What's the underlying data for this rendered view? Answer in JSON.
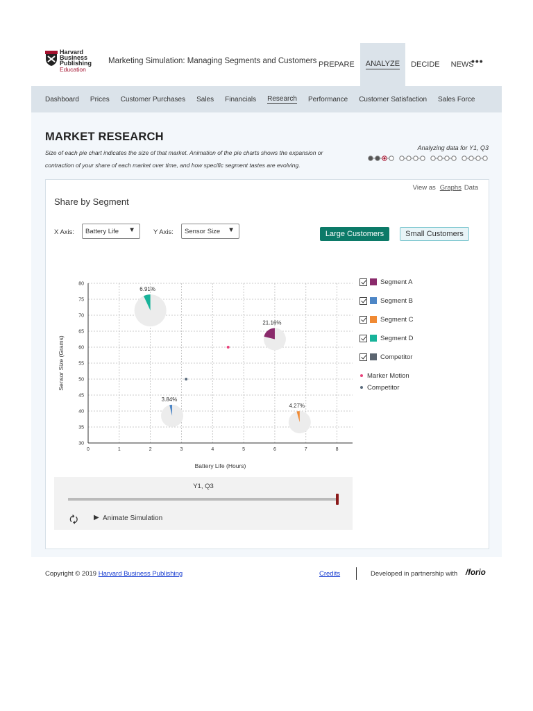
{
  "header": {
    "logo": {
      "line1": "Harvard",
      "line2": "Business",
      "line3": "Publishing",
      "line4": "Education"
    },
    "app_title": "Marketing Simulation: Managing Segments and Customers",
    "nav": [
      {
        "label": "PREPARE",
        "active": false
      },
      {
        "label": "ANALYZE",
        "active": true
      },
      {
        "label": "DECIDE",
        "active": false
      },
      {
        "label": "NEWS",
        "active": false
      }
    ],
    "more_label": "•••"
  },
  "subnav": [
    {
      "label": "Dashboard",
      "active": false
    },
    {
      "label": "Prices",
      "active": false
    },
    {
      "label": "Customer Purchases",
      "active": false
    },
    {
      "label": "Sales",
      "active": false
    },
    {
      "label": "Financials",
      "active": false
    },
    {
      "label": "Research",
      "active": true
    },
    {
      "label": "Performance",
      "active": false
    },
    {
      "label": "Customer Satisfaction",
      "active": false
    },
    {
      "label": "Sales Force",
      "active": false
    }
  ],
  "page": {
    "title": "MARKET RESEARCH",
    "description_line1": "Size of each pie chart indicates the size of that market. Animation of the pie charts shows the expansion or",
    "description_line2": "contraction of your share of each market over time, and how specific segment tastes are evolving.",
    "analyzing_label": "Analyzing data for Y1, Q3",
    "period_dots": {
      "years": 4,
      "quarters_per_year": 4,
      "completed": 2,
      "current_index": 2
    }
  },
  "card": {
    "view_as_label": "View as",
    "view_graphs": "Graphs",
    "view_data": "Data",
    "title": "Share by Segment",
    "x_axis_label": "X Axis:",
    "x_axis_value": "Battery Life",
    "y_axis_label": "Y Axis:",
    "y_axis_value": "Sensor Size",
    "large_customers": "Large Customers",
    "small_customers": "Small Customers"
  },
  "chart_data": {
    "type": "scatter",
    "xlabel": "Battery Life (Hours)",
    "ylabel": "Sensor Size (Grams)",
    "xlim": [
      0,
      8.5
    ],
    "ylim": [
      30,
      80
    ],
    "x_ticks": [
      0,
      1,
      2,
      3,
      4,
      5,
      6,
      7,
      8
    ],
    "y_ticks": [
      30,
      35,
      40,
      45,
      50,
      55,
      60,
      65,
      70,
      75,
      80
    ],
    "grid": true,
    "pies": [
      {
        "segment": "Segment A",
        "x": 6.0,
        "y": 62.5,
        "share_label": "21.16%",
        "share": 0.2116,
        "color": "#8a2a6b",
        "market_size": "medium"
      },
      {
        "segment": "Segment B",
        "x": 2.7,
        "y": 38.5,
        "share_label": "3.84%",
        "share": 0.0384,
        "color": "#4d86c6",
        "market_size": "medium"
      },
      {
        "segment": "Segment C",
        "x": 6.8,
        "y": 36.5,
        "share_label": "4.27%",
        "share": 0.0427,
        "color": "#f08a34",
        "market_size": "medium"
      },
      {
        "segment": "Segment D",
        "x": 2.0,
        "y": 71.5,
        "share_label": "6.91%",
        "share": 0.0691,
        "color": "#18b39a",
        "market_size": "large"
      }
    ],
    "points": [
      {
        "name": "Marker Motion",
        "x": 4.5,
        "y": 60,
        "color": "#e8417a"
      },
      {
        "name": "Competitor",
        "x": 3.15,
        "y": 50,
        "color": "#5a6b7c"
      }
    ]
  },
  "legend": {
    "checkbox_items": [
      {
        "label": "Segment A",
        "color": "#8a2a6b"
      },
      {
        "label": "Segment B",
        "color": "#4d86c6"
      },
      {
        "label": "Segment C",
        "color": "#f08a34"
      },
      {
        "label": "Segment D",
        "color": "#18b39a"
      },
      {
        "label": "Competitor",
        "color": "#5b6570"
      }
    ],
    "dot_items": [
      {
        "label": "Marker Motion",
        "color": "#e8417a"
      },
      {
        "label": "Competitor",
        "color": "#5a6b7c"
      }
    ]
  },
  "animation": {
    "period_label": "Y1, Q3",
    "progress": 1.0,
    "play_label": "Animate Simulation"
  },
  "footer": {
    "copyright_prefix": "Copyright © 2019",
    "copyright_link": "Harvard Business Publishing",
    "credits": "Credits",
    "developed_with": "Developed in partnership with",
    "partner": "/forio"
  }
}
